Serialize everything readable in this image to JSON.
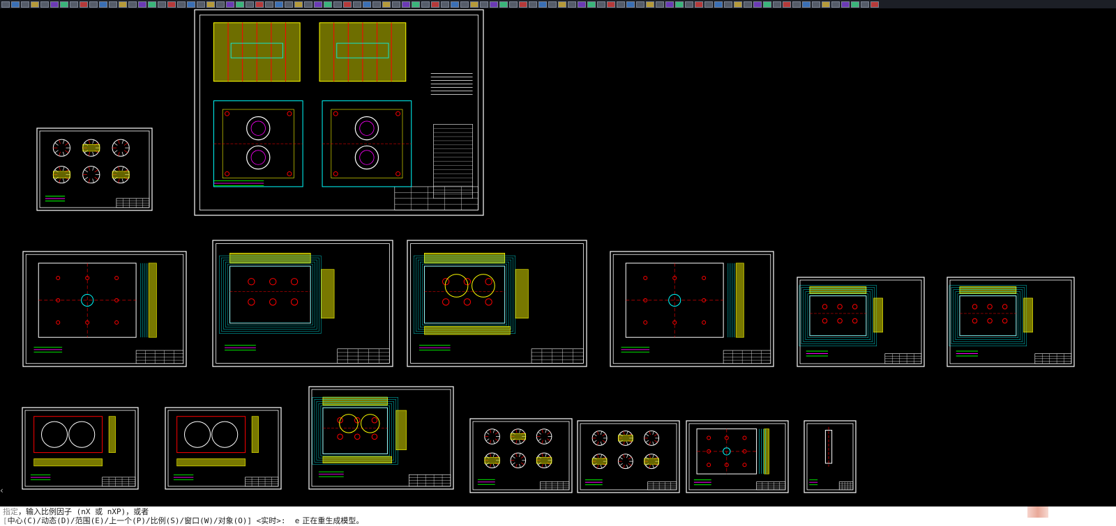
{
  "window": {
    "toolbar_icon_count": 90
  },
  "command_line": {
    "line1_prefix": "指定",
    "line1_text": "，输入比例因子 (nX 或 nXP)，或者",
    "line2_prefix": "[",
    "line2_text": "中心(C)/动态(D)/范围(E)/上一个(P)/比例(S)/窗口(W)/对象(O)] <实时>:  e",
    "line2_status": "正在重生成模型。"
  },
  "colors": {
    "background": "#000000",
    "frame": "#ffffff",
    "yellow": "#ffff00",
    "cyan": "#00ffff",
    "red": "#ff0000",
    "green": "#00ff00",
    "magenta": "#ff00ff",
    "hatch": "#c8c800"
  },
  "icons": {
    "left_arrow": "‹"
  }
}
